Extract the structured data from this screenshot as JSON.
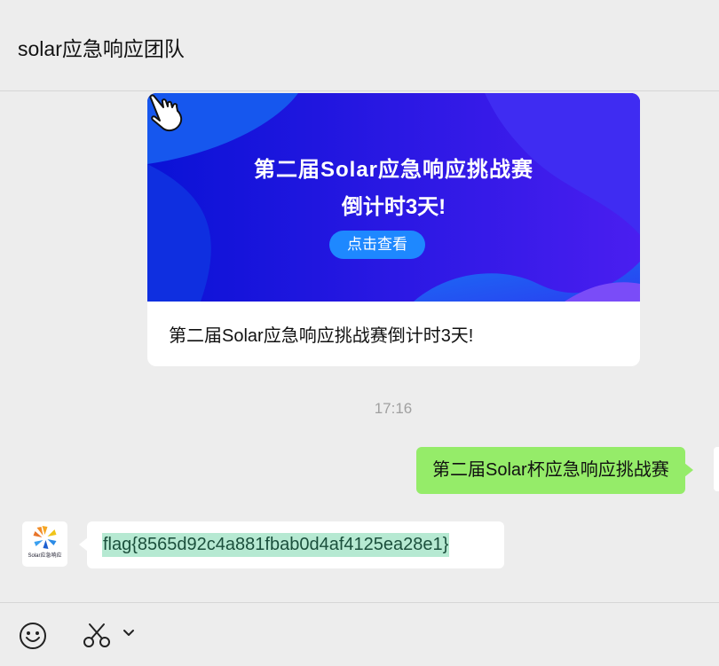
{
  "header": {
    "title": "solar应急响应团队"
  },
  "card": {
    "banner_title": "第二届Solar应急响应挑战赛",
    "banner_sub": "倒计时3天!",
    "banner_button": "点击查看",
    "caption": "第二届Solar应急响应挑战赛倒计时3天!"
  },
  "timestamp": "17:16",
  "outgoing": {
    "text": "第二届Solar杯应急响应挑战赛"
  },
  "incoming": {
    "avatar_text": "Solar应急响应",
    "text": "flag{8565d92c4a881fbab0d4af4125ea28e1}"
  },
  "toolbar": {
    "emoji_icon": "smile-icon",
    "scissors_icon": "scissors-icon",
    "dropdown_icon": "chevron-down-icon"
  },
  "colors": {
    "background": "#ededed",
    "outgoing_bubble": "#95ec69",
    "incoming_bubble": "#ffffff",
    "banner": "#0a10d8",
    "flag_highlight": "#b6e9d2"
  }
}
